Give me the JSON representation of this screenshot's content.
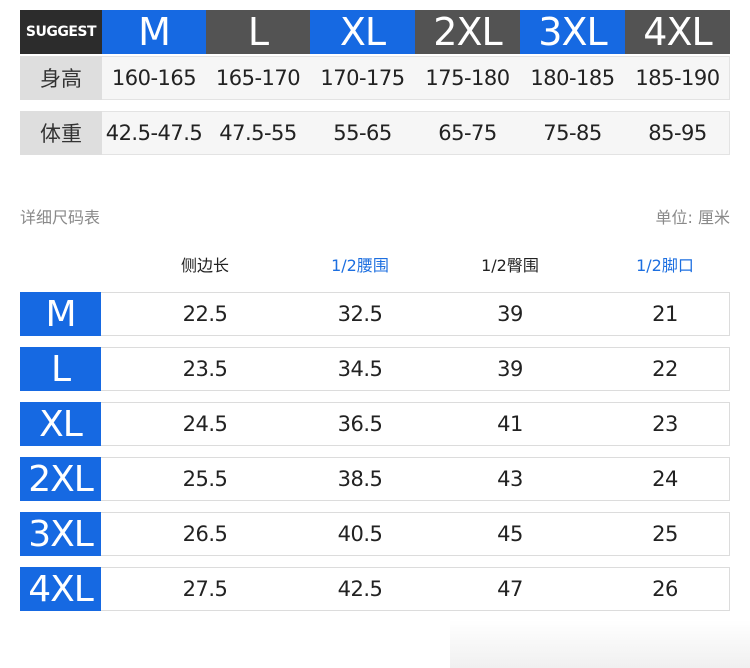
{
  "suggest": {
    "label": "SUGGEST",
    "sizes": [
      "M",
      "L",
      "XL",
      "2XL",
      "3XL",
      "4XL"
    ],
    "size_colors": [
      "#1669e2",
      "#535353",
      "#1669e2",
      "#535353",
      "#1669e2",
      "#535353"
    ],
    "height_label": "身高",
    "heights": [
      "160-165",
      "165-170",
      "170-175",
      "175-180",
      "180-185",
      "185-190"
    ],
    "weight_label": "体重",
    "weights": [
      "42.5-47.5",
      "47.5-55",
      "55-65",
      "65-75",
      "75-85",
      "85-95"
    ]
  },
  "detail": {
    "title": "详细尺码表",
    "unit": "单位: 厘米",
    "columns": [
      "侧边长",
      "1/2腰围",
      "1/2臀围",
      "1/2脚口"
    ],
    "rows": [
      {
        "size": "M",
        "values": [
          "22.5",
          "32.5",
          "39",
          "21"
        ]
      },
      {
        "size": "L",
        "values": [
          "23.5",
          "34.5",
          "39",
          "22"
        ]
      },
      {
        "size": "XL",
        "values": [
          "24.5",
          "36.5",
          "41",
          "23"
        ]
      },
      {
        "size": "2XL",
        "values": [
          "25.5",
          "38.5",
          "43",
          "24"
        ]
      },
      {
        "size": "3XL",
        "values": [
          "26.5",
          "40.5",
          "45",
          "25"
        ]
      },
      {
        "size": "4XL",
        "values": [
          "27.5",
          "42.5",
          "47",
          "26"
        ]
      }
    ]
  },
  "colors": {
    "accent_blue": "#1669e2",
    "dark_gray": "#535353",
    "label_dark": "#2c2c2c",
    "header_blue_text": "#1d6fe0"
  }
}
